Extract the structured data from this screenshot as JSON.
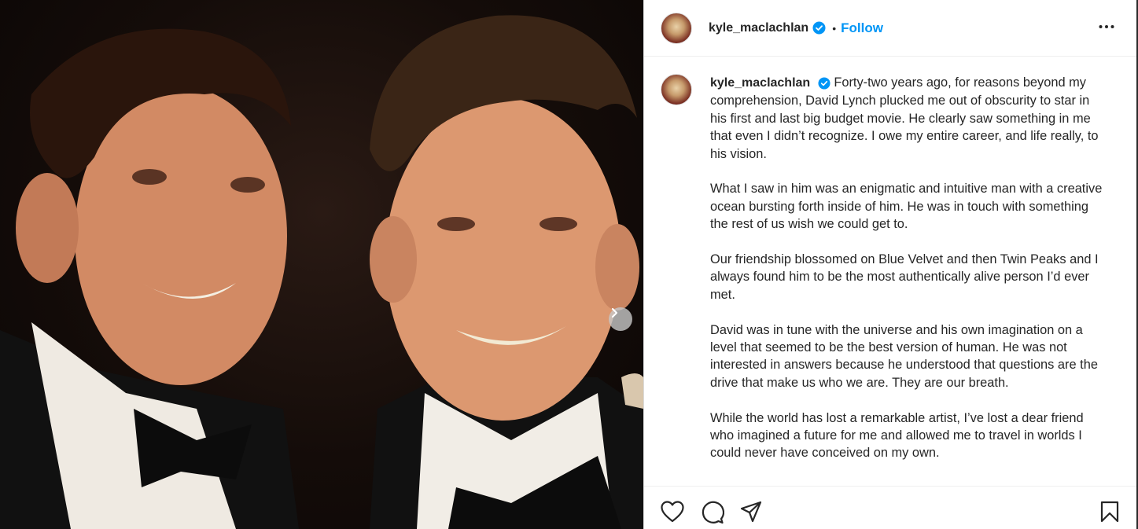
{
  "post": {
    "username": "kyle_maclachlan",
    "verified": true,
    "dot": "•",
    "follow_label": "Follow",
    "more_icon": "more-options-icon"
  },
  "caption": {
    "username": "kyle_maclachlan",
    "paragraphs": [
      "Forty-two years ago, for reasons beyond my comprehension, David Lynch plucked me out of obscurity to star in his first and last big budget movie. He clearly saw something in me that even I didn’t recognize. I owe my entire career, and life really, to his vision.",
      "What I saw in him was an enigmatic and intuitive man with a creative ocean bursting forth inside of him. He was in touch with something the rest of us wish we could get to.",
      "Our friendship blossomed on Blue Velvet and then Twin Peaks and I always found him to be the most authentically alive person I’d ever met.",
      "David was in tune with the universe and his own imagination on a level that seemed to be the best version of human. He was not interested in answers because he understood that questions are the drive that make us who we are. They are our breath.",
      "While the world has lost a remarkable artist, I’ve lost a dear friend who imagined a future for me and allowed me to travel in worlds I could never have conceived on my own."
    ]
  },
  "actions": {
    "icons": [
      "heart-icon",
      "comment-icon",
      "share-icon",
      "save-icon"
    ]
  },
  "colors": {
    "follow": "#0095f6",
    "verified": "#0095f6",
    "text": "#262626"
  }
}
